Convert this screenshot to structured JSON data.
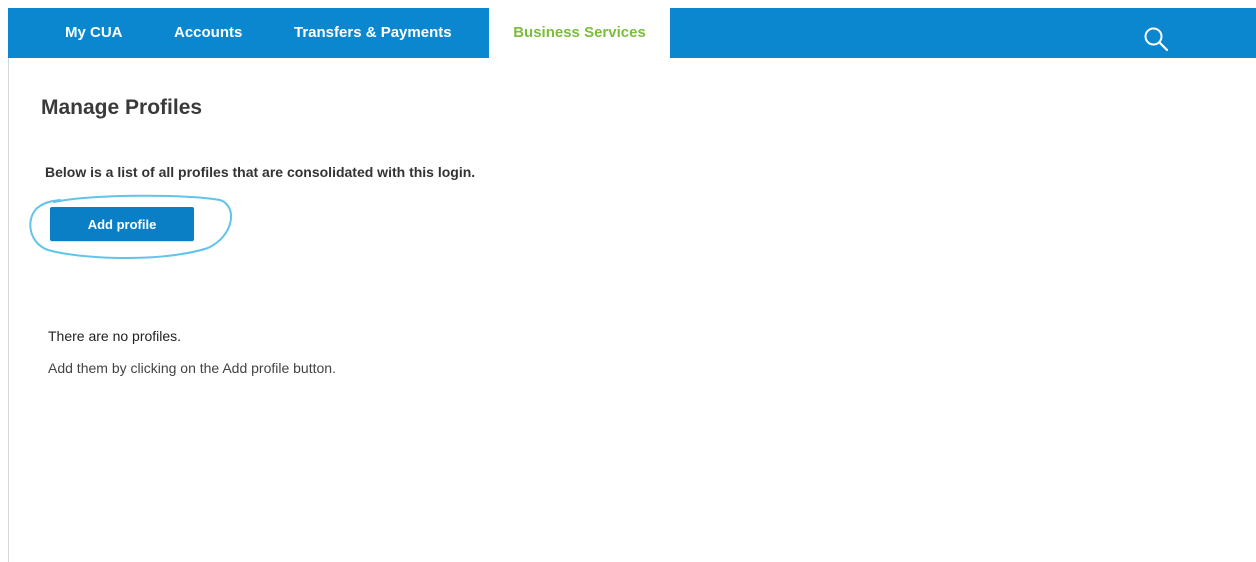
{
  "nav": {
    "items": [
      {
        "label": "My CUA"
      },
      {
        "label": "Accounts"
      },
      {
        "label": "Transfers & Payments"
      },
      {
        "label": "Business Services",
        "active": true
      }
    ],
    "search_icon": "search-icon",
    "background_color": "#0b87cf",
    "active_text_color": "#7bbd3c"
  },
  "page": {
    "title": "Manage Profiles",
    "intro": "Below is a list of all profiles that are consolidated with this login.",
    "add_button_label": "Add profile",
    "empty_title": "There are no profiles.",
    "empty_message": "Add them by clicking on the Add profile button."
  },
  "annotation": {
    "type": "hand-drawn ellipse around Add profile button",
    "color": "#62c4e8"
  }
}
